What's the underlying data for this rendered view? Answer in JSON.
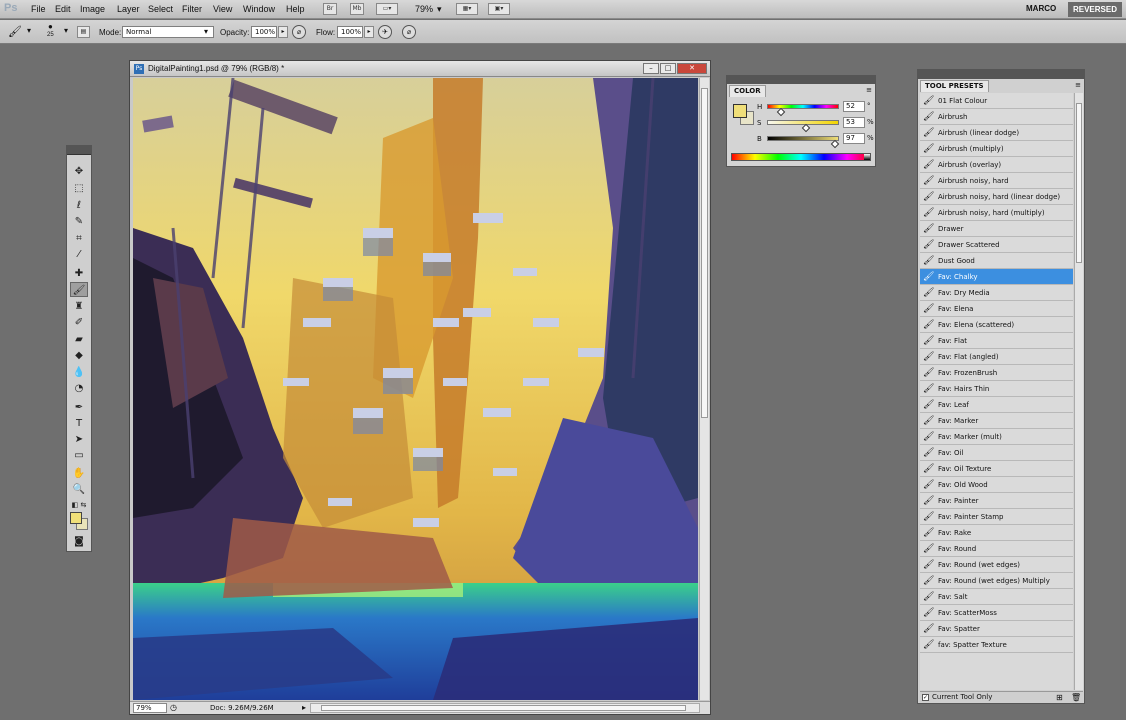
{
  "app": {
    "logo": "Ps"
  },
  "menu": [
    "File",
    "Edit",
    "Image",
    "Layer",
    "Select",
    "Filter",
    "View",
    "Window",
    "Help"
  ],
  "menubar": {
    "br": "Br",
    "mb": "Mb",
    "zoom": "79%",
    "workspace_user": "MARCO",
    "workspace_mode": "REVERSED"
  },
  "options": {
    "brush_size": "25",
    "mode_label": "Mode:",
    "mode_value": "Normal",
    "opacity_label": "Opacity:",
    "opacity_value": "100%",
    "flow_label": "Flow:",
    "flow_value": "100%"
  },
  "document": {
    "title": "DigitalPainting1.psd @ 79% (RGB/8) *",
    "zoom": "79%",
    "doc_size": "Doc: 9.26M/9.26M"
  },
  "color_panel": {
    "tab": "COLOR",
    "fg_color": "#f0df79",
    "h_label": "H",
    "h_value": "52",
    "h_unit": "°",
    "s_label": "S",
    "s_value": "53",
    "s_unit": "%",
    "b_label": "B",
    "b_value": "97",
    "b_unit": "%",
    "h_level": 0.144,
    "s_level": 0.53,
    "b_level": 0.97
  },
  "tool_presets": {
    "tab": "TOOL PRESETS",
    "active_index": 11,
    "items": [
      "01 Flat Colour",
      "Airbrush",
      "Airbrush (linear dodge)",
      "Airbrush (multiply)",
      "Airbrush (overlay)",
      "Airbrush noisy, hard",
      "Airbrush noisy, hard (linear dodge)",
      "Airbrush noisy, hard (multiply)",
      "Drawer",
      "Drawer Scattered",
      "Dust Good",
      "Fav: Chalky",
      "Fav: Dry Media",
      "Fav: Elena",
      "Fav: Elena (scattered)",
      "Fav: Flat",
      "Fav: Flat (angled)",
      "Fav: FrozenBrush",
      "Fav: Hairs Thin",
      "Fav: Leaf",
      "Fav: Marker",
      "Fav: Marker (mult)",
      "Fav: Oil",
      "Fav: Oil Texture",
      "Fav: Old Wood",
      "Fav: Painter",
      "Fav: Painter Stamp",
      "Fav: Rake",
      "Fav: Round",
      "Fav: Round (wet edges)",
      "Fav: Round (wet edges) Multiply",
      "Fav: Salt",
      "Fav: ScatterMoss",
      "Fav: Spatter",
      "fav: Spatter Texture"
    ],
    "footer_label": "Current Tool Only"
  }
}
